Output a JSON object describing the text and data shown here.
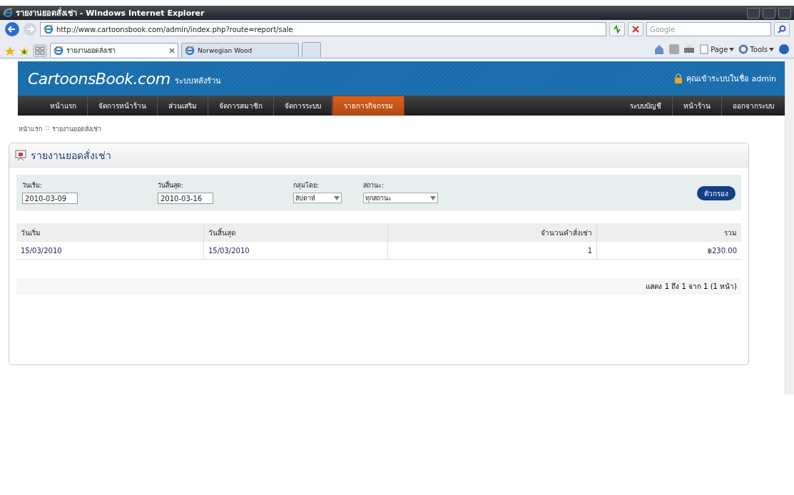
{
  "window": {
    "title": "รายงานยอดสั่งเช่า - Windows Internet Explorer"
  },
  "browser": {
    "url": "http://www.cartoonsbook.com/admin/index.php?route=report/sale",
    "search": {
      "placeholder": "Google"
    },
    "tabs": [
      {
        "label": "รายงานยอดสั่งเช่า",
        "selected": true
      },
      {
        "label": "Norwegian Wood",
        "selected": false
      }
    ],
    "toolbar": [
      "Page",
      "Tools"
    ]
  },
  "site": {
    "logo": "CartoonsBook.com",
    "subtitle": "ระบบหลังร้าน",
    "login": "คุณเข้าระบบในชื่อ admin",
    "nav_left": [
      {
        "label": "หน้าแรก",
        "selected": false
      },
      {
        "label": "จัดการหน้าร้าน",
        "selected": false
      },
      {
        "label": "ส่วนเสริม",
        "selected": false
      },
      {
        "label": "จัดการสมาชิก",
        "selected": false
      },
      {
        "label": "จัดการระบบ",
        "selected": false
      },
      {
        "label": "รายการกิจกรรม",
        "selected": true
      }
    ],
    "nav_right": [
      "ระบบบัญชี",
      "หน้าร้าน",
      "ออกจากระบบ"
    ],
    "breadcrumb": [
      "หน้าแรก",
      "::",
      "รายงานยอดสั่งเช่า"
    ]
  },
  "report": {
    "title": "รายงานยอดสั่งเช่า",
    "filters": [
      {
        "label": "วันเริ่ม:",
        "kind": "text",
        "value": "2010-03-09"
      },
      {
        "label": "วันสิ้นสุด:",
        "kind": "text",
        "value": "2010-03-16"
      },
      {
        "label": "กลุ่มโดย:",
        "kind": "select",
        "value": "สัปดาห์"
      },
      {
        "label": "สถานะ:",
        "kind": "select",
        "value": "ทุกสถานะ"
      }
    ],
    "filter_button": "ตัวกรอง",
    "table": {
      "columns": [
        "วันเริ่ม",
        "วันสิ้นสุด",
        "จำนวนคำสั่งเช่า",
        "รวม"
      ],
      "rows": [
        [
          "15/03/2010",
          "15/03/2010",
          "1",
          "฿230.00"
        ]
      ]
    },
    "pagination": "แสดง 1 ถึง 1 จาก 1 (1 หน้า)"
  }
}
